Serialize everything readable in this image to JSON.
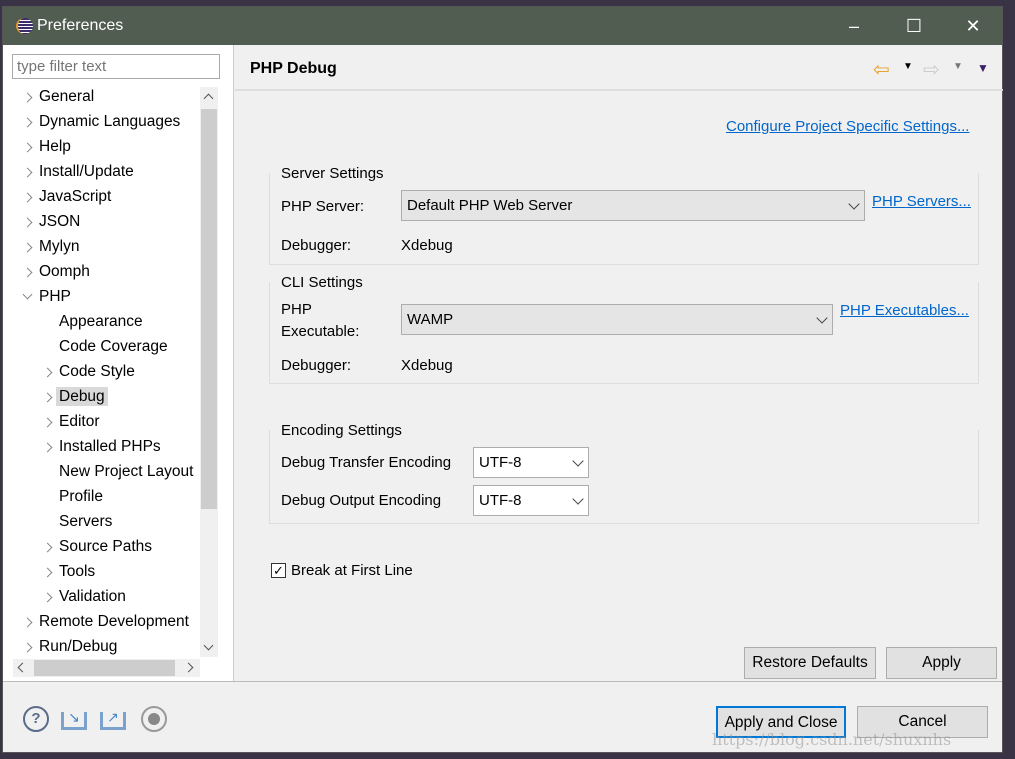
{
  "window": {
    "title": "Preferences",
    "controls": [
      "minimize",
      "maximize",
      "close"
    ]
  },
  "filter": {
    "placeholder": "type filter text"
  },
  "tree": [
    {
      "label": "General",
      "level": 0,
      "expandable": true
    },
    {
      "label": "Dynamic Languages",
      "level": 0,
      "expandable": true
    },
    {
      "label": "Help",
      "level": 0,
      "expandable": true
    },
    {
      "label": "Install/Update",
      "level": 0,
      "expandable": true
    },
    {
      "label": "JavaScript",
      "level": 0,
      "expandable": true
    },
    {
      "label": "JSON",
      "level": 0,
      "expandable": true
    },
    {
      "label": "Mylyn",
      "level": 0,
      "expandable": true
    },
    {
      "label": "Oomph",
      "level": 0,
      "expandable": true
    },
    {
      "label": "PHP",
      "level": 0,
      "expandable": true,
      "expanded": true
    },
    {
      "label": "Appearance",
      "level": 1,
      "expandable": false
    },
    {
      "label": "Code Coverage",
      "level": 1,
      "expandable": false
    },
    {
      "label": "Code Style",
      "level": 1,
      "expandable": true
    },
    {
      "label": "Debug",
      "level": 1,
      "expandable": true,
      "selected": true
    },
    {
      "label": "Editor",
      "level": 1,
      "expandable": true
    },
    {
      "label": "Installed PHPs",
      "level": 1,
      "expandable": true
    },
    {
      "label": "New Project Layout",
      "level": 1,
      "expandable": false
    },
    {
      "label": "Profile",
      "level": 1,
      "expandable": false
    },
    {
      "label": "Servers",
      "level": 1,
      "expandable": false
    },
    {
      "label": "Source Paths",
      "level": 1,
      "expandable": true
    },
    {
      "label": "Tools",
      "level": 1,
      "expandable": true
    },
    {
      "label": "Validation",
      "level": 1,
      "expandable": true
    },
    {
      "label": "Remote Development",
      "level": 0,
      "expandable": true
    },
    {
      "label": "Run/Debug",
      "level": 0,
      "expandable": true
    }
  ],
  "page": {
    "title": "PHP Debug",
    "configure_link": "Configure Project Specific Settings...",
    "server": {
      "group": "Server Settings",
      "php_server_label": "PHP Server:",
      "php_server_value": "Default PHP Web Server",
      "servers_link": "PHP Servers...",
      "debugger_label": "Debugger:",
      "debugger_value": "Xdebug"
    },
    "cli": {
      "group": "CLI Settings",
      "exe_label_1": "PHP",
      "exe_label_2": "Executable:",
      "exe_value": "WAMP",
      "exe_link": "PHP Executables...",
      "debugger_label": "Debugger:",
      "debugger_value": "Xdebug"
    },
    "encoding": {
      "group": "Encoding Settings",
      "transfer_label": "Debug Transfer Encoding",
      "transfer_value": "UTF-8",
      "output_label": "Debug Output Encoding",
      "output_value": "UTF-8"
    },
    "break_first_line": {
      "label": "Break at First Line",
      "checked": true
    },
    "restore_defaults": "Restore Defaults",
    "apply": "Apply"
  },
  "footer": {
    "apply_close": "Apply and Close",
    "cancel": "Cancel",
    "icons": [
      "help-icon",
      "import-icon",
      "export-icon",
      "record-icon"
    ]
  },
  "watermark": "https://blog.csdn.net/shuxnhs"
}
